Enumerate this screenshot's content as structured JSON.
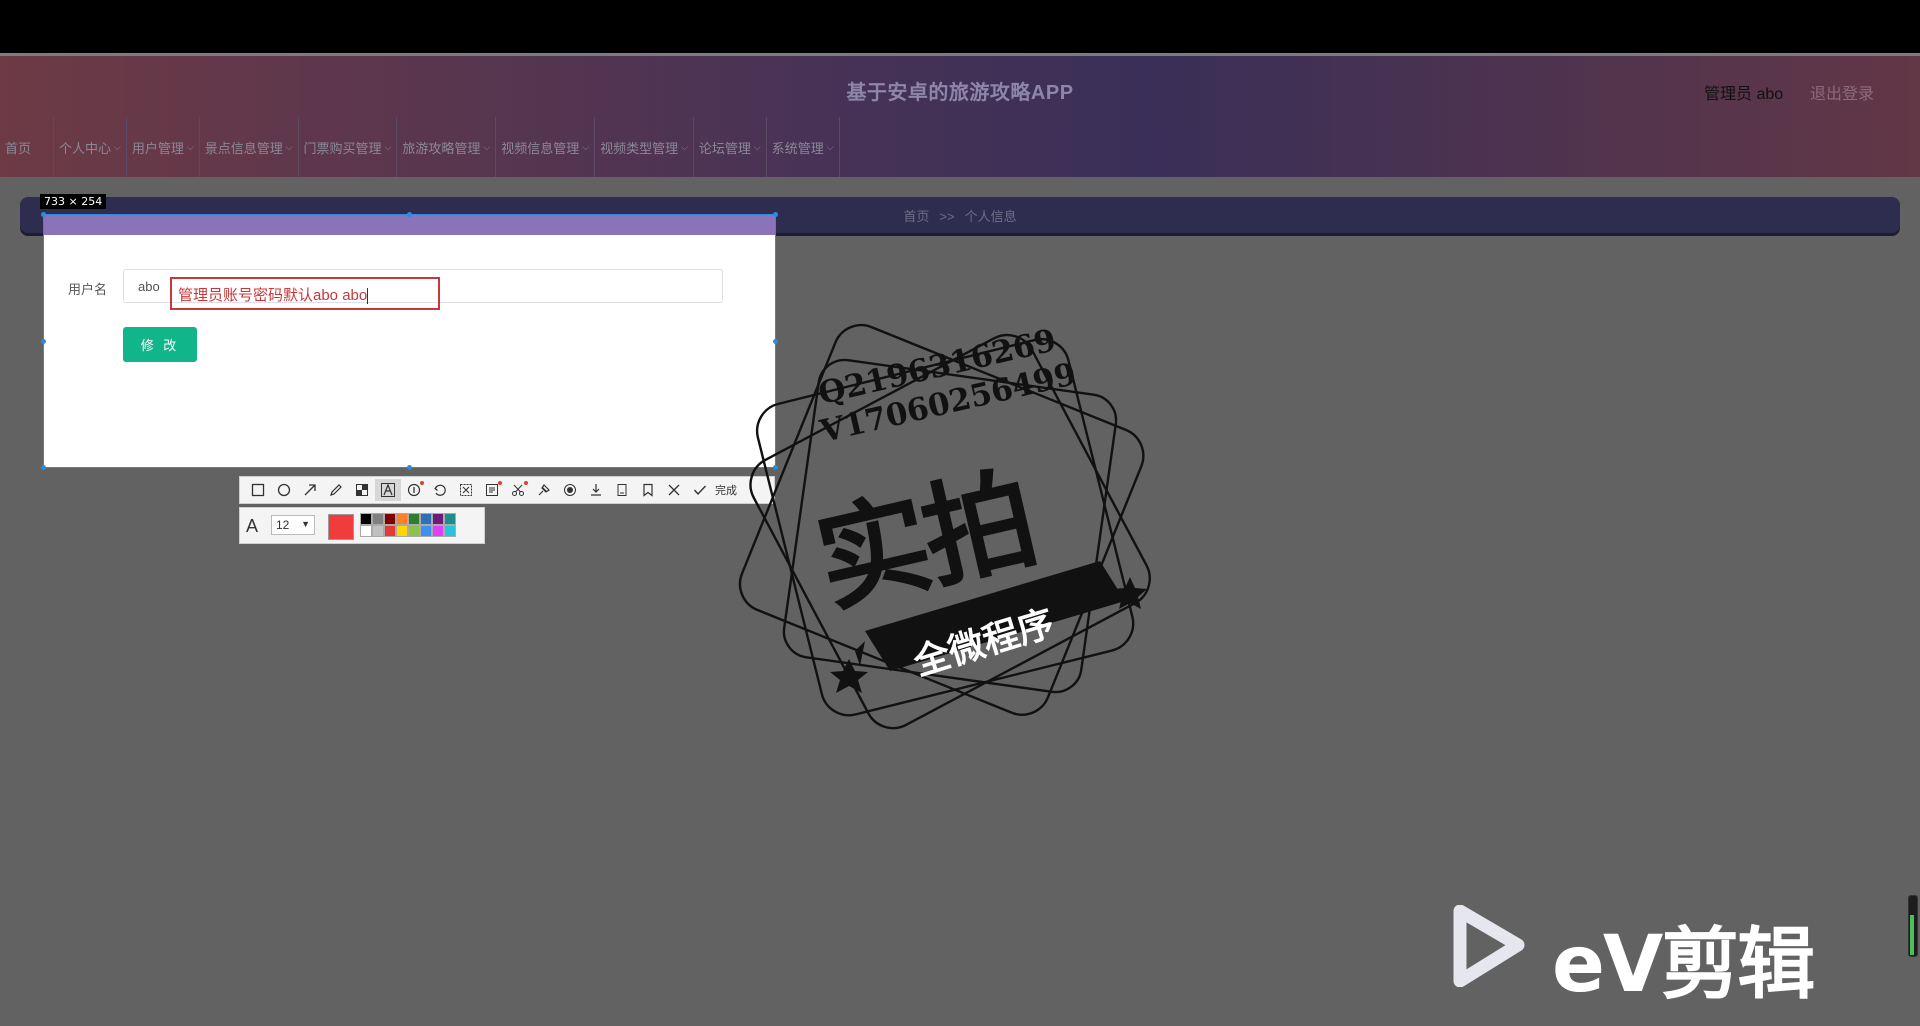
{
  "header": {
    "title": "基于安卓的旅游攻略APP",
    "user": "管理员 abo",
    "logout": "退出登录"
  },
  "nav": {
    "home": "首页",
    "items": [
      {
        "label": "个人中心"
      },
      {
        "label": "用户管理"
      },
      {
        "label": "景点信息管理"
      },
      {
        "label": "门票购买管理"
      },
      {
        "label": "旅游攻略管理"
      },
      {
        "label": "视频信息管理"
      },
      {
        "label": "视频类型管理"
      },
      {
        "label": "论坛管理"
      },
      {
        "label": "系统管理"
      }
    ]
  },
  "breadcrumb": {
    "home": "首页",
    "separator": ">>",
    "current": "个人信息"
  },
  "capture": {
    "size_label": "733 × 254"
  },
  "form": {
    "username_label": "用户名",
    "username_value": "abo",
    "annotation_text": "管理员账号密码默认abo abo",
    "modify_button": "修 改"
  },
  "capture_toolbar": {
    "tools": [
      "rectangle-icon",
      "ellipse-icon",
      "arrow-icon",
      "pencil-icon",
      "mosaic-icon",
      "text-icon",
      "number-icon",
      "undo-icon",
      "cut-icon",
      "ocr-icon",
      "scissors-icon",
      "pin-icon",
      "record-icon",
      "download-icon",
      "copy-icon",
      "bookmark-icon",
      "close-icon",
      "check-icon"
    ],
    "done_label": "完成",
    "font_size": "12",
    "current_color": "#f03c3c",
    "palette_row1": [
      "#000000",
      "#808080",
      "#800000",
      "#ff7f27",
      "#2e7d32",
      "#2f6fb5",
      "#6b1b7b",
      "#1c8c8c"
    ],
    "palette_row2": [
      "#ffffff",
      "#c0c0c0",
      "#e53935",
      "#ffd600",
      "#8bc34a",
      "#3f8ff0",
      "#e040fb",
      "#26c6da"
    ]
  },
  "watermark": {
    "qq": "Q2196316269",
    "wechat": "V17060256499",
    "big_text": "实拍",
    "banner": "全微程序",
    "ev_text": "eV剪辑"
  }
}
